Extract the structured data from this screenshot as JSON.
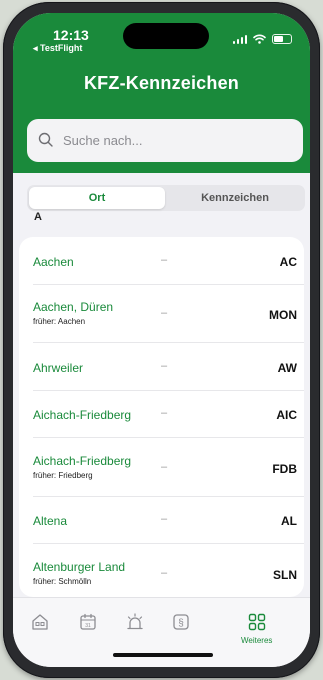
{
  "status_bar": {
    "time": "12:13",
    "back_app": "◂ TestFlight"
  },
  "header": {
    "title": "KFZ-Kennzeichen",
    "background_color": "#1a8a3b"
  },
  "search": {
    "placeholder": "Suche nach...",
    "value": ""
  },
  "segmented_control": {
    "options": [
      "Ort",
      "Kennzeichen"
    ],
    "selected": "Ort"
  },
  "section": {
    "letter": "A"
  },
  "list": {
    "rows": [
      {
        "name": "Aachen",
        "former": "",
        "dash": "–",
        "code": "AC"
      },
      {
        "name": "Aachen, Düren",
        "former": "früher: Aachen",
        "dash": "–",
        "code": "MON"
      },
      {
        "name": "Ahrweiler",
        "former": "",
        "dash": "–",
        "code": "AW"
      },
      {
        "name": "Aichach-Friedberg",
        "former": "",
        "dash": "–",
        "code": "AIC"
      },
      {
        "name": "Aichach-Friedberg",
        "former": "früher: Friedberg",
        "dash": "–",
        "code": "FDB"
      },
      {
        "name": "Altena",
        "former": "",
        "dash": "–",
        "code": "AL"
      },
      {
        "name": "Altenburger Land",
        "former": "früher: Schmölln",
        "dash": "–",
        "code": "SLN"
      }
    ]
  },
  "tab_bar": {
    "tabs": [
      {
        "icon": "house-icon",
        "label": ""
      },
      {
        "icon": "calendar-icon",
        "label": ""
      },
      {
        "icon": "alarm-light-icon",
        "label": ""
      },
      {
        "icon": "paragraph-icon",
        "label": ""
      },
      {
        "icon": "grid-icon",
        "label": "Weiteres"
      }
    ],
    "active_color": "#1a8a3b"
  }
}
